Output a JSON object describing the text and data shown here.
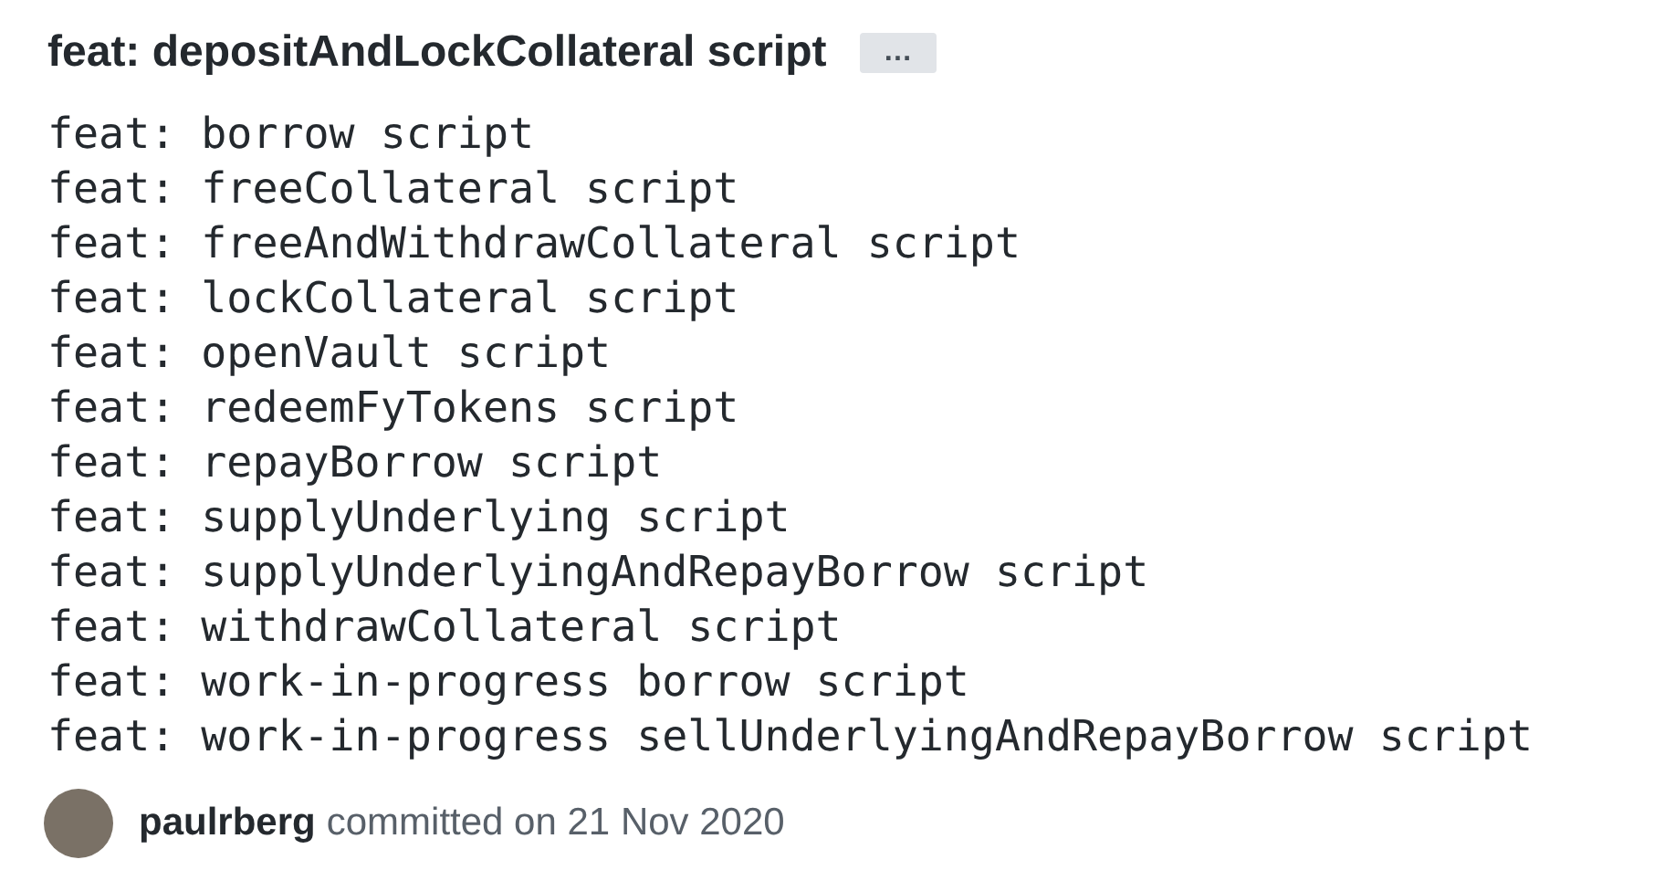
{
  "commit": {
    "title": "feat: depositAndLockCollateral script",
    "expand_button": "…",
    "body": [
      "feat: borrow script",
      "feat: freeCollateral script",
      "feat: freeAndWithdrawCollateral script",
      "feat: lockCollateral script",
      "feat: openVault script",
      "feat: redeemFyTokens script",
      "feat: repayBorrow script",
      "feat: supplyUnderlying script",
      "feat: supplyUnderlyingAndRepayBorrow script",
      "feat: withdrawCollateral script",
      "feat: work-in-progress borrow script",
      "feat: work-in-progress sellUnderlyingAndRepayBorrow script"
    ],
    "author": "paulrberg",
    "committed_text": "committed on 21 Nov 2020"
  }
}
